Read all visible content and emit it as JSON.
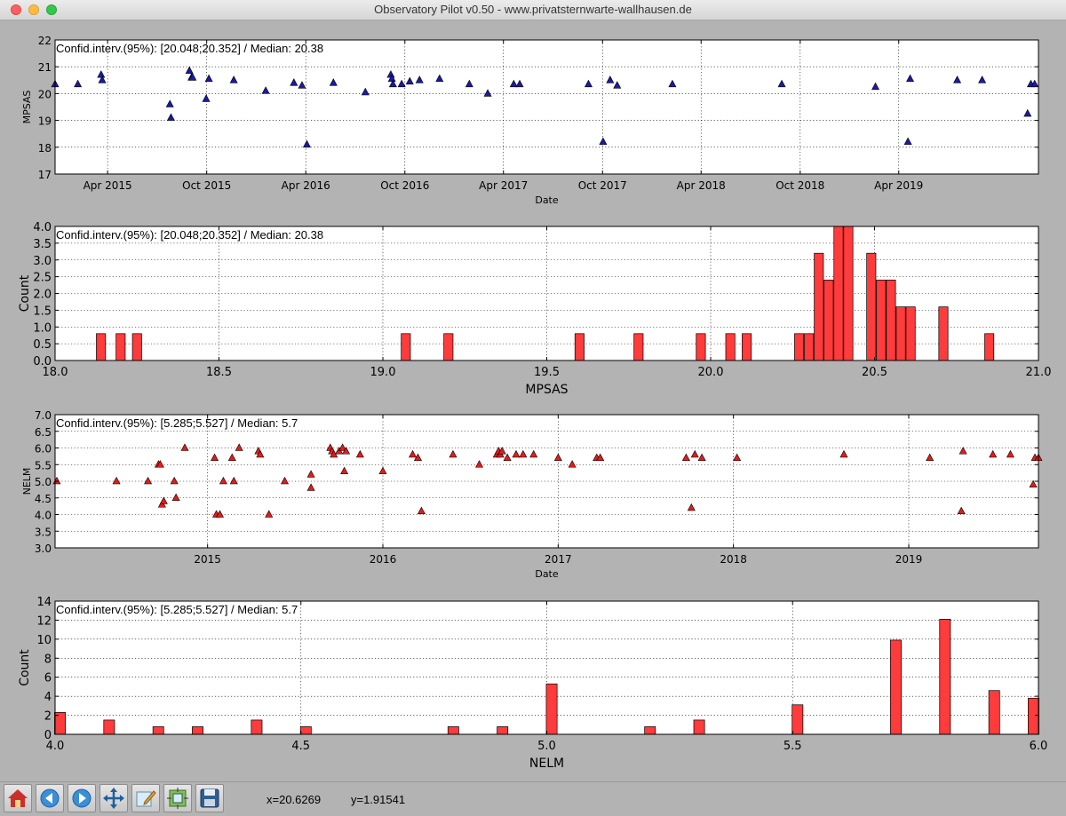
{
  "window": {
    "title": "Observatory Pilot v0.50 - www.privatsternwarte-wallhausen.de"
  },
  "toolbar": {
    "buttons": [
      {
        "name": "home-button",
        "icon": "home-icon"
      },
      {
        "name": "back-button",
        "icon": "arrow-left-icon"
      },
      {
        "name": "forward-button",
        "icon": "arrow-right-icon"
      },
      {
        "name": "pan-button",
        "icon": "move-icon"
      },
      {
        "name": "edit-button",
        "icon": "edit-icon"
      },
      {
        "name": "configure-button",
        "icon": "configure-icon"
      },
      {
        "name": "save-button",
        "icon": "save-icon"
      }
    ],
    "x_readout": "x=20.6269",
    "y_readout": "y=1.91541"
  },
  "colors": {
    "bar_fill": "#ff3b3b",
    "scatter_blue": "#1a1aa8",
    "scatter_red": "#e61a1a",
    "axes_bg": "#ffffff"
  },
  "chart_data": [
    {
      "type": "scatter",
      "annotation": "Confid.interv.(95%): [20.048;20.352] / Median: 20.38",
      "xlabel": "Date",
      "ylabel": "MPSAS",
      "xlim": [
        "2014-12-25",
        "2019-12-15"
      ],
      "ylim": [
        17,
        22
      ],
      "xticks": [
        {
          "x": "2015-04-01",
          "label": "Apr 2015"
        },
        {
          "x": "2015-10-01",
          "label": "Oct 2015"
        },
        {
          "x": "2016-04-01",
          "label": "Apr 2016"
        },
        {
          "x": "2016-10-01",
          "label": "Oct 2016"
        },
        {
          "x": "2017-04-01",
          "label": "Apr 2017"
        },
        {
          "x": "2017-10-01",
          "label": "Oct 2017"
        },
        {
          "x": "2018-04-01",
          "label": "Apr 2018"
        },
        {
          "x": "2018-10-01",
          "label": "Oct 2018"
        },
        {
          "x": "2019-04-01",
          "label": "Apr 2019"
        }
      ],
      "yticks": [
        17,
        18,
        19,
        20,
        21,
        22
      ],
      "marker": "triangle",
      "color": "#1a1aa8",
      "points": [
        [
          "2014-12-25",
          20.35
        ],
        [
          "2015-02-05",
          20.35
        ],
        [
          "2015-03-20",
          20.7
        ],
        [
          "2015-03-22",
          20.5
        ],
        [
          "2015-07-25",
          19.6
        ],
        [
          "2015-07-27",
          19.1
        ],
        [
          "2015-08-30",
          20.85
        ],
        [
          "2015-09-03",
          20.6
        ],
        [
          "2015-09-05",
          20.6
        ],
        [
          "2015-09-30",
          19.8
        ],
        [
          "2015-10-05",
          20.55
        ],
        [
          "2015-11-20",
          20.5
        ],
        [
          "2016-01-18",
          20.1
        ],
        [
          "2016-03-10",
          20.4
        ],
        [
          "2016-03-25",
          20.3
        ],
        [
          "2016-04-03",
          18.1
        ],
        [
          "2016-05-22",
          20.4
        ],
        [
          "2016-07-20",
          20.05
        ],
        [
          "2016-09-05",
          20.7
        ],
        [
          "2016-09-07",
          20.55
        ],
        [
          "2016-09-09",
          20.35
        ],
        [
          "2016-09-25",
          20.35
        ],
        [
          "2016-10-10",
          20.45
        ],
        [
          "2016-10-28",
          20.5
        ],
        [
          "2016-12-04",
          20.55
        ],
        [
          "2017-01-28",
          20.35
        ],
        [
          "2017-03-03",
          20.0
        ],
        [
          "2017-04-20",
          20.35
        ],
        [
          "2017-05-01",
          20.35
        ],
        [
          "2017-09-05",
          20.35
        ],
        [
          "2017-10-02",
          18.2
        ],
        [
          "2017-10-15",
          20.5
        ],
        [
          "2017-10-28",
          20.3
        ],
        [
          "2018-02-07",
          20.35
        ],
        [
          "2018-08-28",
          20.35
        ],
        [
          "2019-02-17",
          20.25
        ],
        [
          "2019-04-18",
          18.2
        ],
        [
          "2019-04-22",
          20.55
        ],
        [
          "2019-07-18",
          20.5
        ],
        [
          "2019-09-02",
          20.5
        ],
        [
          "2019-11-25",
          19.25
        ],
        [
          "2019-12-01",
          20.35
        ],
        [
          "2019-12-08",
          20.35
        ]
      ]
    },
    {
      "type": "bar",
      "annotation": "Confid.interv.(95%): [20.048;20.352] / Median: 20.38",
      "xlabel": "MPSAS",
      "ylabel": "Count",
      "xlim": [
        18.0,
        21.0
      ],
      "ylim": [
        0,
        4.0
      ],
      "xticks": [
        18.0,
        18.5,
        19.0,
        19.5,
        20.0,
        20.5,
        21.0
      ],
      "yticks": [
        0.0,
        0.5,
        1.0,
        1.5,
        2.0,
        2.5,
        3.0,
        3.5,
        4.0
      ],
      "bin_width": 0.028,
      "bars": [
        [
          18.14,
          0.8
        ],
        [
          18.2,
          0.8
        ],
        [
          18.25,
          0.8
        ],
        [
          19.07,
          0.8
        ],
        [
          19.2,
          0.8
        ],
        [
          19.6,
          0.8
        ],
        [
          19.78,
          0.8
        ],
        [
          19.97,
          0.8
        ],
        [
          20.06,
          0.8
        ],
        [
          20.11,
          0.8
        ],
        [
          20.27,
          0.8
        ],
        [
          20.3,
          0.8
        ],
        [
          20.33,
          3.2
        ],
        [
          20.36,
          2.4
        ],
        [
          20.39,
          4.0
        ],
        [
          20.42,
          4.0
        ],
        [
          20.49,
          3.2
        ],
        [
          20.52,
          2.4
        ],
        [
          20.55,
          2.4
        ],
        [
          20.58,
          1.6
        ],
        [
          20.61,
          1.6
        ],
        [
          20.71,
          1.6
        ],
        [
          20.85,
          0.8
        ]
      ]
    },
    {
      "type": "scatter",
      "annotation": "Confid.interv.(95%): [5.285;5.527] / Median: 5.7",
      "xlabel": "Date",
      "ylabel": "NELM",
      "xlim": [
        2014.13,
        2019.74
      ],
      "ylim": [
        3.0,
        7.0
      ],
      "xticks": [
        {
          "x": 2015,
          "label": "2015"
        },
        {
          "x": 2016,
          "label": "2016"
        },
        {
          "x": 2017,
          "label": "2017"
        },
        {
          "x": 2018,
          "label": "2018"
        },
        {
          "x": 2019,
          "label": "2019"
        }
      ],
      "yticks": [
        3.0,
        3.5,
        4.0,
        4.5,
        5.0,
        5.5,
        6.0,
        6.5,
        7.0
      ],
      "marker": "triangle",
      "color": "#e61a1a",
      "points": [
        [
          2014.14,
          5.0
        ],
        [
          2014.48,
          5.0
        ],
        [
          2014.66,
          5.0
        ],
        [
          2014.72,
          5.5
        ],
        [
          2014.73,
          5.5
        ],
        [
          2014.74,
          4.3
        ],
        [
          2014.75,
          4.4
        ],
        [
          2014.81,
          5.0
        ],
        [
          2014.82,
          4.5
        ],
        [
          2014.87,
          6.0
        ],
        [
          2015.04,
          5.7
        ],
        [
          2015.05,
          4.0
        ],
        [
          2015.07,
          4.0
        ],
        [
          2015.09,
          5.0
        ],
        [
          2015.14,
          5.7
        ],
        [
          2015.15,
          5.0
        ],
        [
          2015.18,
          6.0
        ],
        [
          2015.29,
          5.9
        ],
        [
          2015.3,
          5.8
        ],
        [
          2015.35,
          4.0
        ],
        [
          2015.44,
          5.0
        ],
        [
          2015.59,
          5.2
        ],
        [
          2015.59,
          4.8
        ],
        [
          2015.7,
          6.0
        ],
        [
          2015.71,
          5.9
        ],
        [
          2015.72,
          5.8
        ],
        [
          2015.75,
          5.9
        ],
        [
          2015.77,
          6.0
        ],
        [
          2015.78,
          5.3
        ],
        [
          2015.79,
          5.9
        ],
        [
          2015.87,
          5.8
        ],
        [
          2016.0,
          5.3
        ],
        [
          2016.17,
          5.8
        ],
        [
          2016.2,
          5.7
        ],
        [
          2016.22,
          4.1
        ],
        [
          2016.4,
          5.8
        ],
        [
          2016.55,
          5.5
        ],
        [
          2016.65,
          5.8
        ],
        [
          2016.66,
          5.9
        ],
        [
          2016.67,
          5.8
        ],
        [
          2016.68,
          5.9
        ],
        [
          2016.71,
          5.7
        ],
        [
          2016.76,
          5.8
        ],
        [
          2016.8,
          5.8
        ],
        [
          2016.86,
          5.8
        ],
        [
          2017.0,
          5.7
        ],
        [
          2017.08,
          5.5
        ],
        [
          2017.22,
          5.7
        ],
        [
          2017.24,
          5.7
        ],
        [
          2017.73,
          5.7
        ],
        [
          2017.76,
          4.2
        ],
        [
          2017.78,
          5.8
        ],
        [
          2017.82,
          5.7
        ],
        [
          2018.02,
          5.7
        ],
        [
          2018.63,
          5.8
        ],
        [
          2019.12,
          5.7
        ],
        [
          2019.3,
          4.1
        ],
        [
          2019.31,
          5.9
        ],
        [
          2019.48,
          5.8
        ],
        [
          2019.58,
          5.8
        ],
        [
          2019.71,
          4.9
        ],
        [
          2019.72,
          5.7
        ],
        [
          2019.74,
          5.7
        ]
      ]
    },
    {
      "type": "bar",
      "annotation": "Confid.interv.(95%): [5.285;5.527] / Median: 5.7",
      "xlabel": "NELM",
      "ylabel": "Count",
      "xlim": [
        4.0,
        6.0
      ],
      "ylim": [
        0,
        14
      ],
      "xticks": [
        4.0,
        4.5,
        5.0,
        5.5,
        6.0
      ],
      "yticks": [
        0,
        2,
        4,
        6,
        8,
        10,
        12,
        14
      ],
      "bin_width": 0.022,
      "bars": [
        [
          4.01,
          2.3
        ],
        [
          4.11,
          1.5
        ],
        [
          4.21,
          0.8
        ],
        [
          4.29,
          0.8
        ],
        [
          4.41,
          1.5
        ],
        [
          4.51,
          0.8
        ],
        [
          4.81,
          0.8
        ],
        [
          4.91,
          0.8
        ],
        [
          5.01,
          5.3
        ],
        [
          5.21,
          0.8
        ],
        [
          5.31,
          1.5
        ],
        [
          5.51,
          3.1
        ],
        [
          5.71,
          9.9
        ],
        [
          5.81,
          12.1
        ],
        [
          5.91,
          4.6
        ],
        [
          5.99,
          3.8
        ]
      ]
    }
  ]
}
